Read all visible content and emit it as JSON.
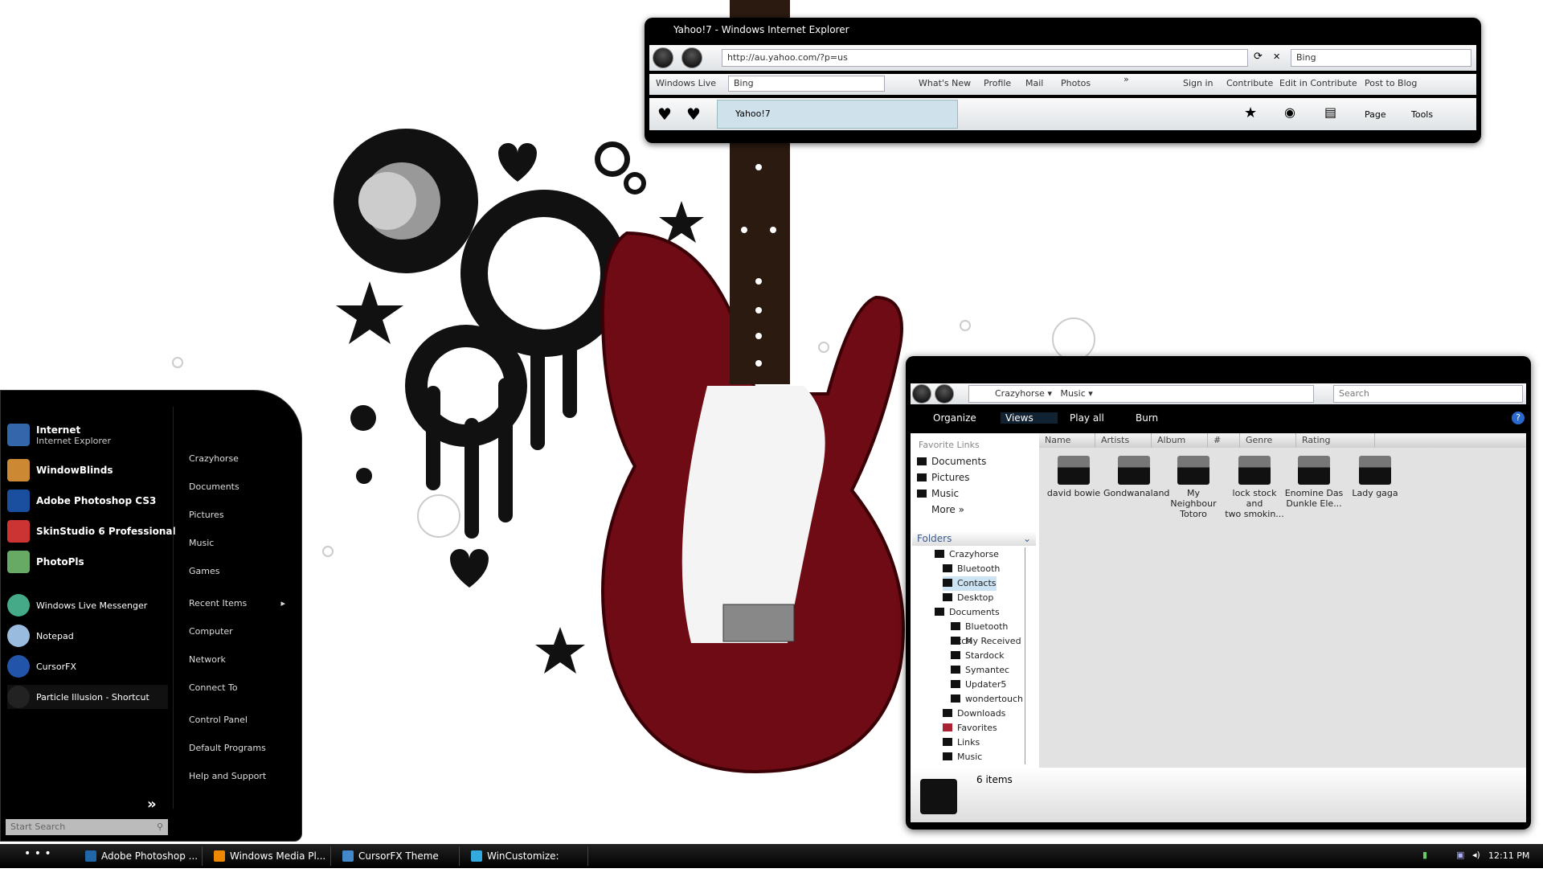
{
  "ie": {
    "title": "Yahoo!7 - Windows Internet Explorer",
    "address": "http://au.yahoo.com/?p=us",
    "search": "Bing",
    "links": {
      "windows_live": "Windows Live",
      "search_box": "Bing",
      "items": [
        "What's New",
        "Profile",
        "Mail",
        "Photos"
      ],
      "more": "»",
      "sign_in": "Sign in",
      "contribute": "Contribute",
      "edit_contribute": "Edit in Contribute",
      "post_blog": "Post to Blog"
    },
    "tab": "Yahoo!7",
    "page": "Page",
    "tools": "Tools"
  },
  "explorer": {
    "breadcrumb": [
      "Crazyhorse",
      "Music"
    ],
    "search_placeholder": "Search",
    "toolbar": {
      "organize": "Organize",
      "views": "Views",
      "play_all": "Play all",
      "burn": "Burn"
    },
    "columns": [
      "Name",
      "Artists",
      "Album",
      "#",
      "Genre",
      "Rating"
    ],
    "favorites_label": "Favorite Links",
    "favorites": [
      "Documents",
      "Pictures",
      "Music"
    ],
    "more": "More »",
    "folders_label": "Folders",
    "tree": [
      "Crazyhorse",
      "Bluetooth Softw",
      "Contacts",
      "Desktop",
      "Documents",
      "Bluetooth Exch",
      "My Received F",
      "Stardock",
      "Symantec",
      "Updater5",
      "wondertouch",
      "Downloads",
      "Favorites",
      "Links",
      "Music"
    ],
    "items": [
      {
        "l1": "david bowie",
        "l2": ""
      },
      {
        "l1": "Gondwanaland",
        "l2": ""
      },
      {
        "l1": "My Neighbour",
        "l2": "Totoro"
      },
      {
        "l1": "lock stock and",
        "l2": "two smokin..."
      },
      {
        "l1": "Enomine Das",
        "l2": "Dunkle Ele..."
      },
      {
        "l1": "Lady gaga",
        "l2": ""
      }
    ],
    "status": "6 items"
  },
  "start_menu": {
    "pinned": [
      {
        "name": "Internet",
        "sub": "Internet Explorer"
      },
      {
        "name": "WindowBlinds"
      },
      {
        "name": "Adobe Photoshop CS3"
      },
      {
        "name": "SkinStudio 6 Professional"
      },
      {
        "name": "PhotoPls"
      }
    ],
    "recent": [
      "Windows Live Messenger",
      "Notepad",
      "CursorFX",
      "Particle Illusion - Shortcut"
    ],
    "right": [
      "Crazyhorse",
      "Documents",
      "Pictures",
      "Music",
      "Games",
      "Recent Items",
      "Computer",
      "Network",
      "Connect To",
      "Control Panel",
      "Default Programs",
      "Help and Support"
    ],
    "all_programs": "»",
    "search_placeholder": "Start Search"
  },
  "taskbar": {
    "tasks": [
      "Adobe Photoshop ...",
      "Windows Media Pl...",
      "CursorFX Theme Ed...",
      "WinCustomize: Sab..."
    ],
    "clock": "12:11 PM"
  }
}
